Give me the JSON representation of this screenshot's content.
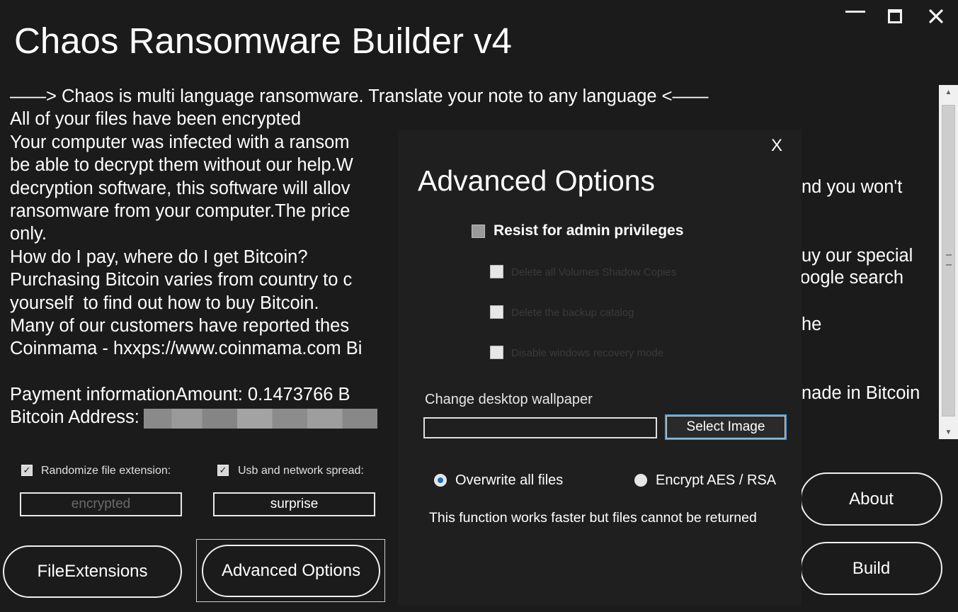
{
  "window": {
    "title": "Chaos Ransomware Builder v4",
    "minimize_icon": "minimize-icon",
    "maximize_icon": "maximize-icon",
    "close_icon": "close-icon"
  },
  "note": {
    "lines": [
      "——> Chaos is multi language ransomware. Translate your note to any language <——",
      "All of your files have been encrypted",
      "Your computer was infected with a ransom",
      "be able to decrypt them without our help.W",
      "decryption software, this software will allov",
      "ransomware from your computer.The price",
      "only.",
      "How do I pay, where do I get Bitcoin?",
      "Purchasing Bitcoin varies from country to c",
      "yourself  to find out how to buy Bitcoin.",
      "Many of our customers have reported thes",
      "Coinmama - hxxps://www.coinmama.com Bi",
      "",
      "Payment informationAmount: 0.1473766 B",
      "Bitcoin Address:"
    ],
    "right_fragments": [
      "nd you won't",
      "uy our special",
      "he",
      "nade in Bitcoin",
      "oogle search"
    ]
  },
  "options": {
    "randomize_label": "Randomize file extension:",
    "randomize_checked": true,
    "randomize_value": "encrypted",
    "spread_label": "Usb and network spread:",
    "spread_checked": true,
    "spread_value": "surprise"
  },
  "buttons": {
    "file_extensions": "FileExtensions",
    "advanced_options": "Advanced Options",
    "about": "About",
    "build": "Build"
  },
  "dialog": {
    "close": "X",
    "title": "Advanced Options",
    "resist_label": "Resist for admin privileges",
    "hidden_options": [
      "Delete all Volumes Shadow Copies",
      "Delete the backup catalog",
      "Disable windows recovery mode"
    ],
    "wallpaper_label": "Change desktop wallpaper",
    "wallpaper_path": "",
    "select_image": "Select Image",
    "radio_overwrite": "Overwrite all files",
    "radio_encrypt": "Encrypt AES / RSA",
    "selected_mode": "overwrite",
    "function_note": "This function works faster but files cannot be returned"
  },
  "colors": {
    "background": "#1b1b1b",
    "text": "#ffffff",
    "focus_border": "#4aa3df",
    "radio_dot": "#1f6fb5"
  }
}
